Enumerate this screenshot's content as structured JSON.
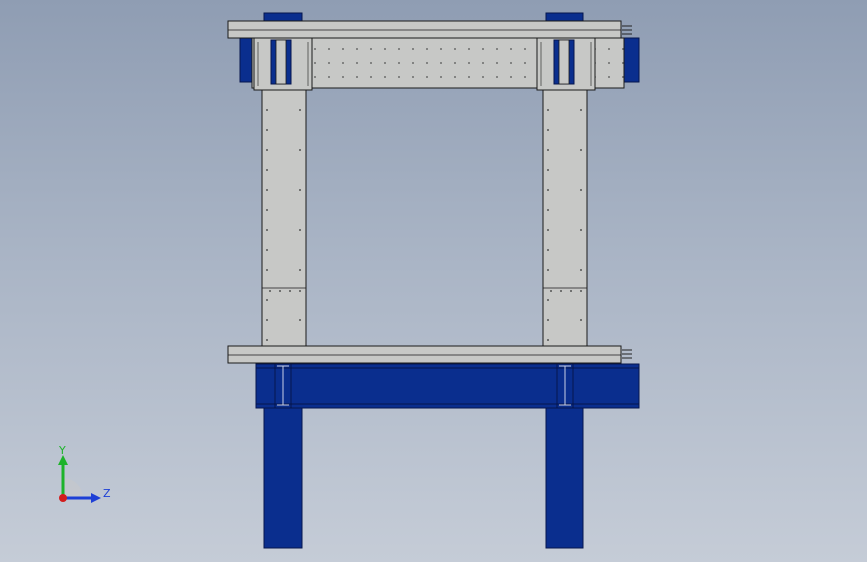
{
  "viewport": {
    "background_top": "#8f9db3",
    "background_bottom": "#c5ccd7"
  },
  "colors": {
    "steel_blue": "#0a2e8e",
    "steel_blue_dark": "#05154d",
    "concrete": "#c7c8c6",
    "concrete_dark": "#b4b5b3",
    "outline": "#1a1a1a",
    "axis_y": "#1db32a",
    "axis_z": "#1d3fd6",
    "axis_x": "#d21c1c"
  },
  "triad": {
    "y_label": "Y",
    "z_label": "Z"
  }
}
